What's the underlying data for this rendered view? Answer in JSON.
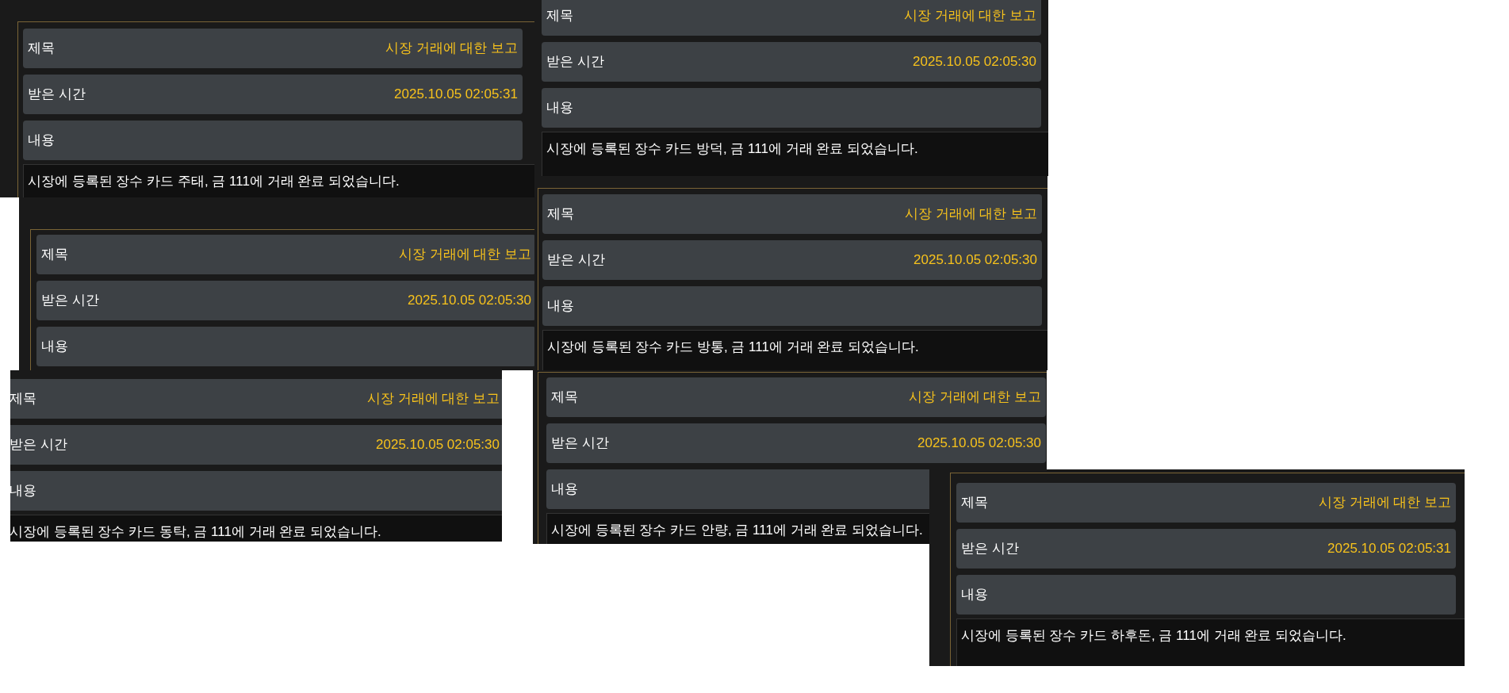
{
  "panels": [
    {
      "title_label": "제목",
      "title": "시장 거래에 대한 보고",
      "time_label": "받은 시간",
      "time": "2025.10.05 02:05:31",
      "content_label": "내용",
      "content": "시장에 등록된 장수 카드 주태, 금 111에 거래 완료 되었습니다."
    },
    {
      "title_label": "제목",
      "title": "시장 거래에 대한 보고",
      "time_label": "받은 시간",
      "time": "2025.10.05 02:05:30",
      "content_label": "내용",
      "content": "시장에 등록된 장수 카드 방덕, 금 111에 거래 완료 되었습니다."
    },
    {
      "title_label": "제목",
      "title": "시장 거래에 대한 보고",
      "time_label": "받은 시간",
      "time": "2025.10.05 02:05:30",
      "content_label": "내용"
    },
    {
      "title_label": "제목",
      "title": "시장 거래에 대한 보고",
      "time_label": "받은 시간",
      "time": "2025.10.05 02:05:30",
      "content_label": "내용",
      "content": "시장에 등록된 장수 카드 방통, 금 111에 거래 완료 되었습니다."
    },
    {
      "title_label": "제목",
      "title": "시장 거래에 대한 보고",
      "time_label": "받은 시간",
      "time": "2025.10.05 02:05:30",
      "content_label": "내용",
      "content": "시장에 등록된 장수 카드 동탁, 금 111에 거래 완료 되었습니다."
    },
    {
      "title_label": "제목",
      "title": "시장 거래에 대한 보고",
      "time_label": "받은 시간",
      "time": "2025.10.05 02:05:30",
      "content_label": "내용",
      "content": "시장에 등록된 장수 카드 안량, 금 111에 거래 완료 되었습니다."
    },
    {
      "title_label": "제목",
      "title": "시장 거래에 대한 보고",
      "time_label": "받은 시간",
      "time": "2025.10.05 02:05:31",
      "content_label": "내용",
      "content": "시장에 등록된 장수 카드 하후돈, 금 111에 거래 완료 되었습니다."
    }
  ]
}
